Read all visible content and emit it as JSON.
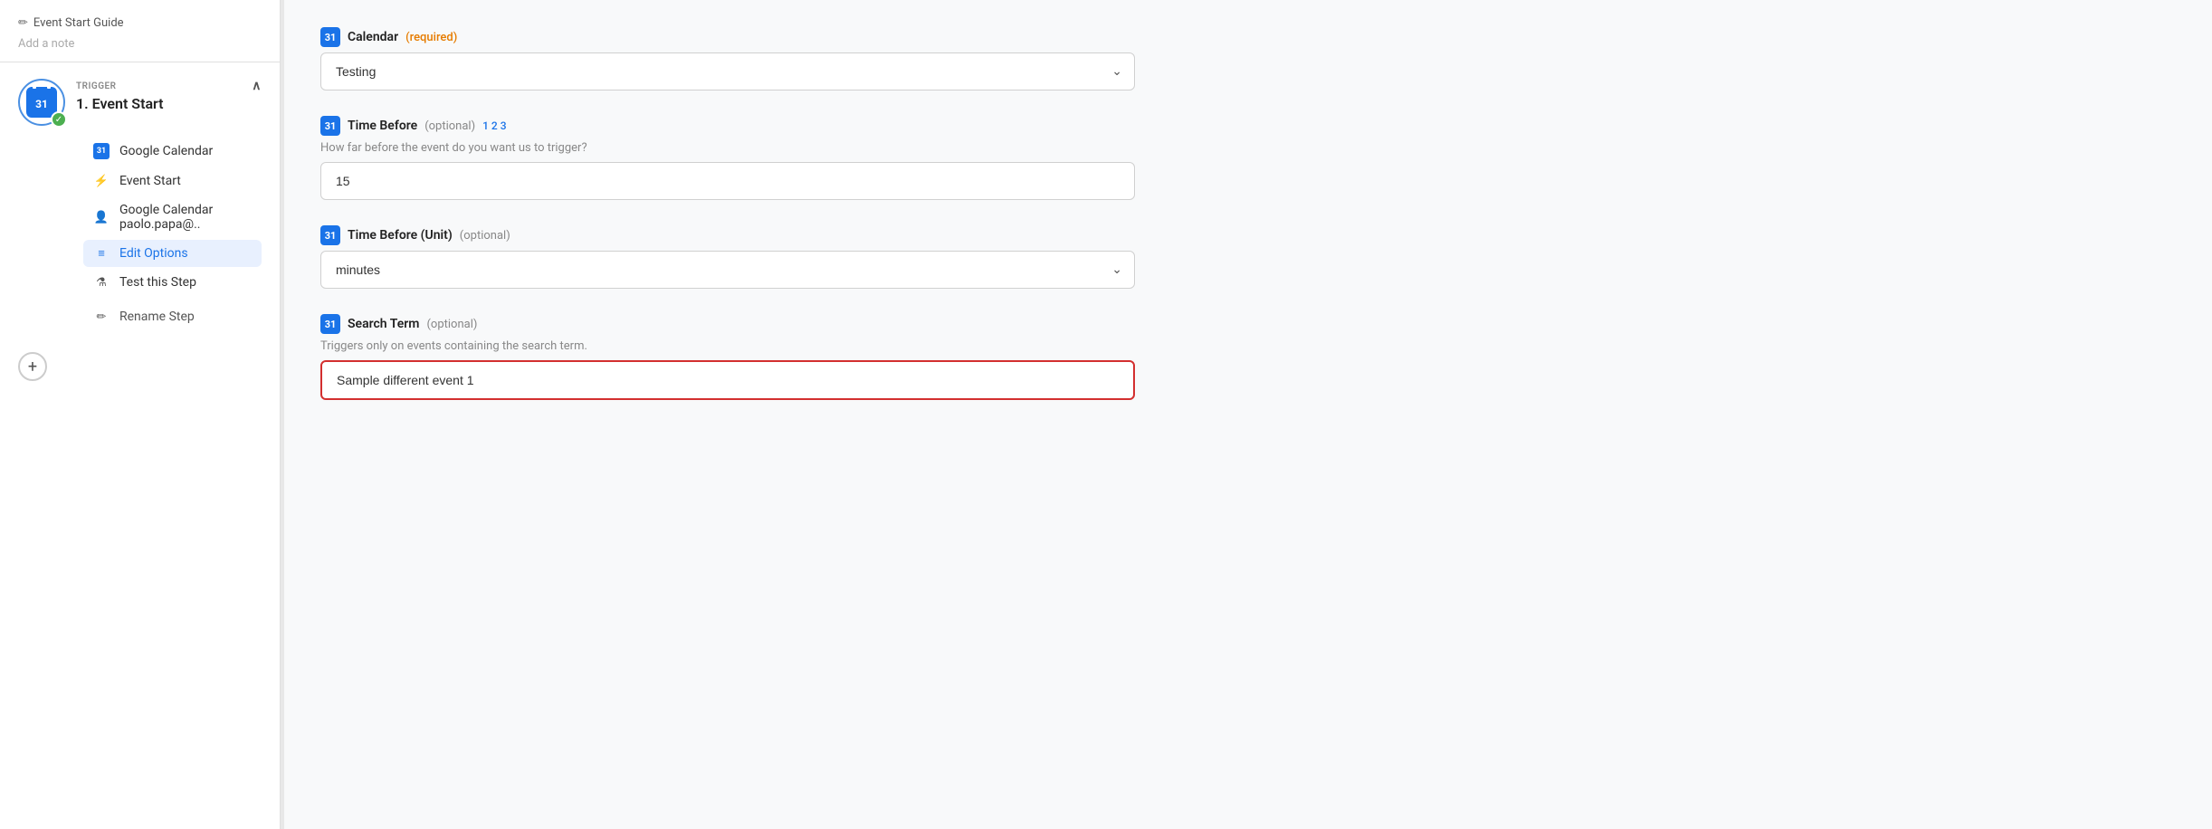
{
  "sidebar": {
    "breadcrumb": "Event Start Guide",
    "add_note": "Add a note",
    "trigger_label": "TRIGGER",
    "trigger_title": "1. Event Start",
    "sub_items": [
      {
        "id": "google-calendar",
        "label": "Google Calendar",
        "icon": "cal"
      },
      {
        "id": "event-start",
        "label": "Event Start",
        "icon": "bolt"
      },
      {
        "id": "account",
        "label": "Google Calendar paolo.papa@..",
        "icon": "person"
      },
      {
        "id": "edit-options",
        "label": "Edit Options",
        "icon": "list",
        "active": true
      },
      {
        "id": "test-step",
        "label": "Test this Step",
        "icon": "flask"
      }
    ],
    "rename_label": "Rename Step",
    "add_btn_label": "+"
  },
  "main": {
    "fields": [
      {
        "id": "calendar",
        "label": "Calendar",
        "required": true,
        "required_text": "(required)",
        "optional_text": "",
        "hint": "",
        "type": "select",
        "value": "Testing",
        "placeholder": ""
      },
      {
        "id": "time-before",
        "label": "Time Before",
        "required": false,
        "optional_text": "(optional)",
        "step_nums": "1 2 3",
        "hint": "How far before the event do you want us to trigger?",
        "type": "input",
        "value": "15",
        "placeholder": ""
      },
      {
        "id": "time-before-unit",
        "label": "Time Before (Unit)",
        "required": false,
        "optional_text": "(optional)",
        "hint": "",
        "type": "select",
        "value": "minutes",
        "placeholder": ""
      },
      {
        "id": "search-term",
        "label": "Search Term",
        "required": false,
        "optional_text": "(optional)",
        "hint": "Triggers only on events containing the search term.",
        "type": "input",
        "value": "Sample different event 1",
        "placeholder": "",
        "highlighted": true
      }
    ]
  },
  "icons": {
    "pencil": "✏",
    "chevron_up": "∧",
    "chevron_down": "⌄",
    "check": "✓",
    "bolt": "⚡",
    "person": "👤",
    "list": "≡",
    "flask": "⚗",
    "pencil_small": "✏",
    "plus": "+"
  },
  "colors": {
    "blue": "#1a73e8",
    "green": "#4caf50",
    "orange": "#e67c00",
    "active_bg": "#e8f0fe",
    "red_border": "#d32f2f"
  }
}
